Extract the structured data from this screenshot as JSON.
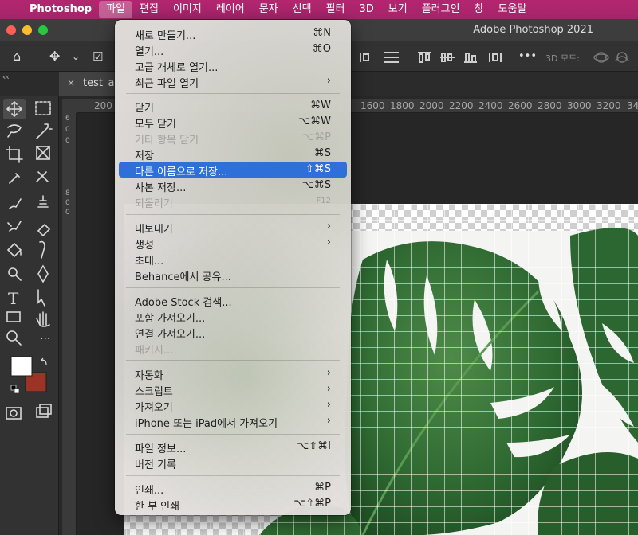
{
  "menubar": {
    "apple_glyph": "",
    "app_name": "Photoshop",
    "items": [
      "파일",
      "편집",
      "이미지",
      "레이어",
      "문자",
      "선택",
      "필터",
      "3D",
      "보기",
      "플러그인",
      "창",
      "도움말"
    ]
  },
  "window": {
    "title": "Adobe Photoshop 2021"
  },
  "options_bar": {
    "home_glyph": "⌂",
    "move_glyph": "✥",
    "dropdown_glyph": "⌄",
    "checkbox_glyph": "☑",
    "more_glyph": "•••",
    "label_3d_mode": "3D 모드:"
  },
  "toolbox": {
    "collapse_glyph": "‹‹"
  },
  "document": {
    "tab_label": "test_a",
    "close_glyph": "×"
  },
  "ruler": {
    "h_ticks": [
      "200",
      "1600",
      "1800",
      "2000",
      "2200",
      "2400",
      "2600",
      "2800",
      "3000",
      "3200",
      "34"
    ],
    "v_ticks": [
      "6",
      "0",
      "0",
      "8",
      "0",
      "0"
    ]
  },
  "file_menu": {
    "groups": [
      [
        {
          "label": "새로 만들기...",
          "shortcut": "⌘N"
        },
        {
          "label": "열기...",
          "shortcut": "⌘O"
        },
        {
          "label": "고급 개체로 열기...",
          "shortcut": ""
        },
        {
          "label": "최근 파일 열기",
          "shortcut": "›"
        }
      ],
      [
        {
          "label": "닫기",
          "shortcut": "⌘W"
        },
        {
          "label": "모두 닫기",
          "shortcut": "⌥⌘W"
        },
        {
          "label": "기타 항목 닫기",
          "shortcut": "⌥⌘P",
          "disabled": true
        },
        {
          "label": "저장",
          "shortcut": "⌘S"
        },
        {
          "label": "다른 이름으로 저장...",
          "shortcut": "⇧⌘S",
          "highlighted": true
        },
        {
          "label": "사본 저장...",
          "shortcut": "⌥⌘S"
        },
        {
          "label": "되돌리기",
          "shortcut": "F12",
          "disabled": true
        }
      ],
      [
        {
          "label": "내보내기",
          "shortcut": "›"
        },
        {
          "label": "생성",
          "shortcut": "›"
        },
        {
          "label": "초대...",
          "shortcut": ""
        },
        {
          "label": "Behance에서 공유...",
          "shortcut": ""
        }
      ],
      [
        {
          "label": "Adobe Stock 검색...",
          "shortcut": ""
        },
        {
          "label": "포함 가져오기...",
          "shortcut": ""
        },
        {
          "label": "연결 가져오기...",
          "shortcut": ""
        },
        {
          "label": "패키지...",
          "shortcut": "",
          "disabled": true
        }
      ],
      [
        {
          "label": "자동화",
          "shortcut": "›"
        },
        {
          "label": "스크립트",
          "shortcut": "›"
        },
        {
          "label": "가져오기",
          "shortcut": "›"
        },
        {
          "label": "iPhone 또는 iPad에서 가져오기",
          "shortcut": "›"
        }
      ],
      [
        {
          "label": "파일 정보...",
          "shortcut": "⌥⇧⌘I"
        },
        {
          "label": "버전 기록",
          "shortcut": ""
        }
      ],
      [
        {
          "label": "인쇄...",
          "shortcut": "⌘P"
        },
        {
          "label": "한 부 인쇄",
          "shortcut": "⌥⇧⌘P"
        }
      ]
    ]
  },
  "colors": {
    "menubar": "#a4246a",
    "highlight": "#2e6fd8",
    "background_swatch": "#9b3326",
    "foreground_swatch": "#ffffff"
  }
}
